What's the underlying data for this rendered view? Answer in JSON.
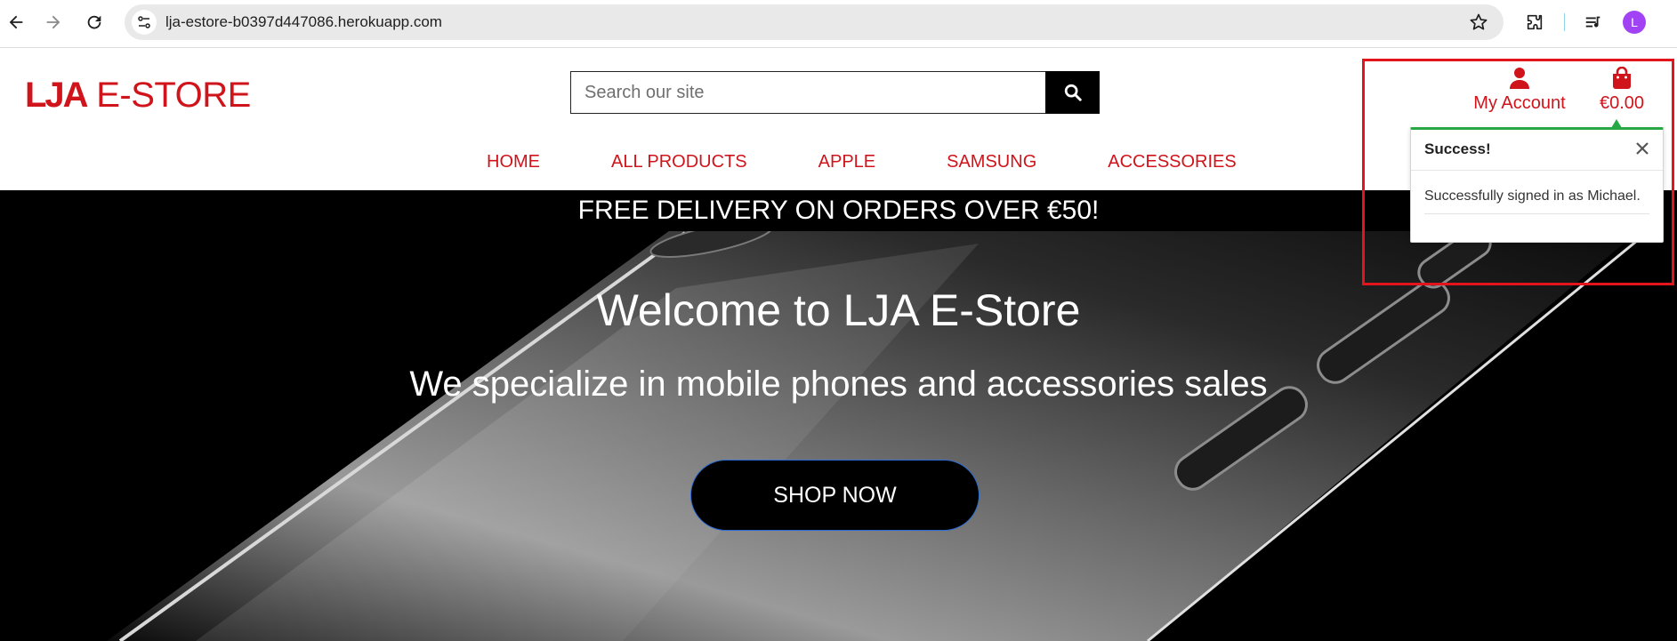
{
  "browser": {
    "url": "lja-estore-b0397d447086.herokuapp.com",
    "profile_initial": "L",
    "icons": [
      "back-arrow-icon",
      "forward-arrow-icon",
      "reload-icon",
      "site-info-icon",
      "bookmark-star-icon",
      "extensions-icon",
      "media-controls-icon"
    ]
  },
  "header": {
    "logo_bold": "LJA",
    "logo_rest": " E-STORE",
    "search": {
      "placeholder": "Search our site"
    },
    "account_label": "My Account",
    "bag_total": "€0.00"
  },
  "nav": {
    "items": [
      {
        "label": "HOME"
      },
      {
        "label": "ALL PRODUCTS"
      },
      {
        "label": "APPLE"
      },
      {
        "label": "SAMSUNG"
      },
      {
        "label": "ACCESSORIES"
      }
    ]
  },
  "hero": {
    "banner": "FREE DELIVERY ON ORDERS OVER €50!",
    "title": "Welcome to LJA E-Store",
    "subtitle": "We specialize in mobile phones and accessories sales",
    "cta_label": "SHOP NOW"
  },
  "toast": {
    "title": "Success!",
    "message": "Successfully signed in as Michael."
  },
  "colors": {
    "brand_red": "#d0141b",
    "success_green": "#28a745",
    "highlight": "#e3141c",
    "cta_border": "#2a6bd6"
  }
}
